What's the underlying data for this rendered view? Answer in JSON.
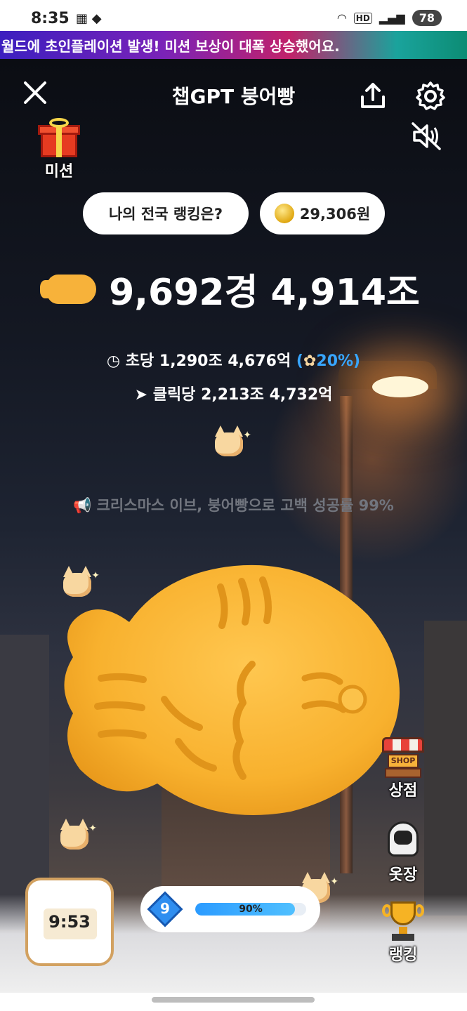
{
  "status_bar": {
    "time": "8:35",
    "network_label": "HD",
    "battery": "78"
  },
  "banner": {
    "text": "월드에 초인플레이션 발생! 미션 보상이 대폭 상승했어요."
  },
  "header": {
    "title": "챕GPT 붕어빵",
    "close_icon": "close-icon",
    "share_icon": "share-icon",
    "settings_icon": "gear-icon",
    "mute_icon": "speaker-muted-icon"
  },
  "mission": {
    "label": "미션"
  },
  "ranking_pill": {
    "label": "나의 전국 랭킹은?"
  },
  "money_pill": {
    "amount": "29,306원"
  },
  "score": {
    "value": "9,692경 4,914조"
  },
  "rates": {
    "per_second_label": "초당 1,290조 4,676억",
    "per_second_bonus_open": "(",
    "per_second_bonus": "20%)",
    "per_click_label": "클릭당 2,213조 4,732억"
  },
  "notice": {
    "text": "크리스마스 이브, 붕어빵으로 고백 성공률 99%"
  },
  "side_menu": {
    "shop_sign": "SHOP",
    "shop_label": "상점",
    "closet_label": "옷장",
    "ranking_label": "랭킹"
  },
  "timer": {
    "value": "9:53"
  },
  "level": {
    "number": "9",
    "progress_text": "90%",
    "progress_fraction": 0.9
  },
  "colors": {
    "accent_blue": "#38a6ff",
    "fish_orange": "#f7b23a",
    "banner_start": "#3c1fbf",
    "banner_end": "#0c8c74"
  }
}
